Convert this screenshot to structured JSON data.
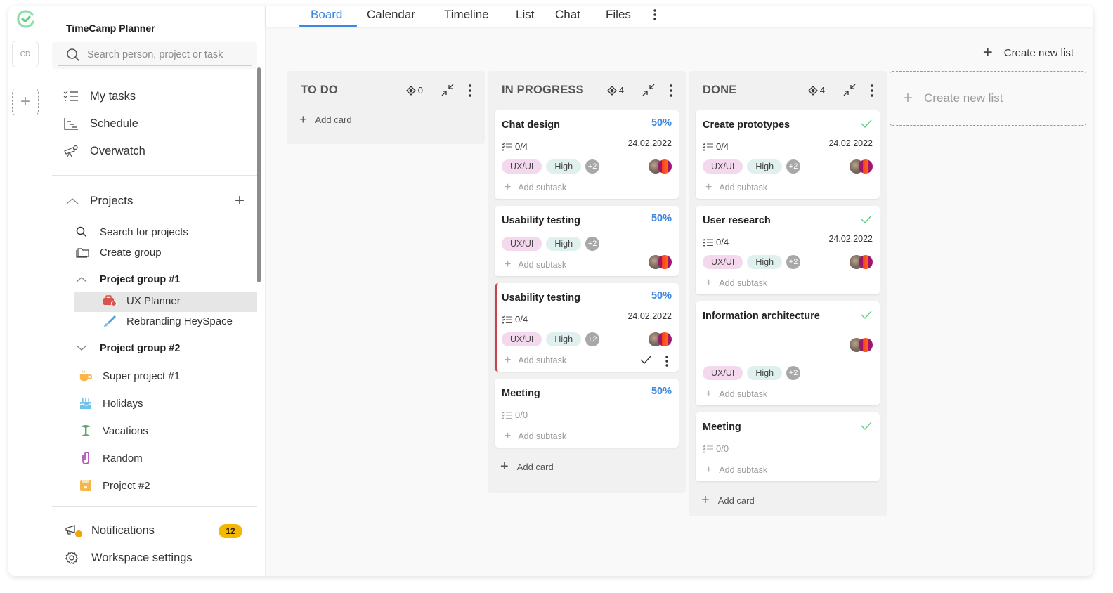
{
  "app": {
    "workspace_initials": "CD",
    "title": "TimeCamp Planner",
    "brand_color": "#5ad17f",
    "accent_color": "#3c86e0"
  },
  "sidebar": {
    "search_placeholder": "Search person, project or task",
    "nav": [
      {
        "label": "My tasks",
        "icon": "checklist-icon"
      },
      {
        "label": "Schedule",
        "icon": "schedule-icon"
      },
      {
        "label": "Overwatch",
        "icon": "telescope-icon"
      }
    ],
    "projects": {
      "label": "Projects",
      "actions": [
        {
          "label": "Search for projects",
          "icon": "search-icon"
        },
        {
          "label": "Create group",
          "icon": "folder-icon"
        }
      ],
      "groups": [
        {
          "label": "Project group #1",
          "expanded": true,
          "items": [
            {
              "label": "UX Planner",
              "icon": "toolbox-icon",
              "color": "#d9534f",
              "selected": true
            },
            {
              "label": "Rebranding HeySpace",
              "icon": "brush-icon",
              "color": "#4aa3df",
              "selected": false
            }
          ]
        },
        {
          "label": "Project group #2",
          "expanded": false,
          "items": []
        }
      ],
      "loose": [
        {
          "label": "Super project #1",
          "icon": "coffee-icon",
          "color": "#f6b64a"
        },
        {
          "label": "Holidays",
          "icon": "cake-icon",
          "color": "#6ec3e8"
        },
        {
          "label": "Vacations",
          "icon": "palm-tree-icon",
          "color": "#5aa86e"
        },
        {
          "label": "Random",
          "icon": "paperclip-icon",
          "color": "#b056b8"
        },
        {
          "label": "Project #2",
          "icon": "floppy-icon",
          "color": "#f6b64a"
        }
      ]
    },
    "footer": {
      "notifications_label": "Notifications",
      "notifications_count": "12",
      "settings_label": "Workspace settings"
    }
  },
  "tabs": [
    {
      "label": "Board",
      "active": true
    },
    {
      "label": "Calendar",
      "active": false
    },
    {
      "label": "Timeline",
      "active": false
    },
    {
      "label": "List",
      "active": false
    },
    {
      "label": "Chat",
      "active": false
    },
    {
      "label": "Files",
      "active": false
    }
  ],
  "board": {
    "create_list_label": "Create new list",
    "add_card_label": "Add card",
    "add_subtask_label": "Add subtask",
    "columns": [
      {
        "title": "TO DO",
        "count": "0",
        "cards": []
      },
      {
        "title": "IN PROGRESS",
        "count": "4",
        "cards": [
          {
            "title": "Chat design",
            "progress": "50%",
            "subtasks": "0/4",
            "due": "24.02.2022",
            "tags": [
              "UX/UI",
              "High"
            ],
            "more_tags": "+2",
            "flagged": false
          },
          {
            "title": "Usability testing",
            "progress": "50%",
            "subtasks": null,
            "due": null,
            "tags": [
              "UX/UI",
              "High"
            ],
            "more_tags": "+2",
            "flagged": false
          },
          {
            "title": "Usability testing",
            "progress": "50%",
            "subtasks": "0/4",
            "due": "24.02.2022",
            "tags": [
              "UX/UI",
              "High"
            ],
            "more_tags": "+2",
            "flagged": true
          },
          {
            "title": "Meeting",
            "progress": "50%",
            "subtasks": "0/0",
            "due": null,
            "tags": [],
            "more_tags": null,
            "flagged": false
          }
        ]
      },
      {
        "title": "DONE",
        "count": "4",
        "cards": [
          {
            "title": "Create prototypes",
            "done": true,
            "subtasks": "0/4",
            "due": "24.02.2022",
            "tags": [
              "UX/UI",
              "High"
            ],
            "more_tags": "+2"
          },
          {
            "title": "User research",
            "done": true,
            "subtasks": "0/4",
            "due": "24.02.2022",
            "tags": [
              "UX/UI",
              "High"
            ],
            "more_tags": "+2"
          },
          {
            "title": "Information architecture",
            "done": true,
            "subtasks": null,
            "due": null,
            "tags": [
              "UX/UI",
              "High"
            ],
            "more_tags": "+2"
          },
          {
            "title": "Meeting",
            "done": true,
            "subtasks": "0/0",
            "due": null,
            "tags": [],
            "more_tags": null
          }
        ]
      }
    ]
  }
}
